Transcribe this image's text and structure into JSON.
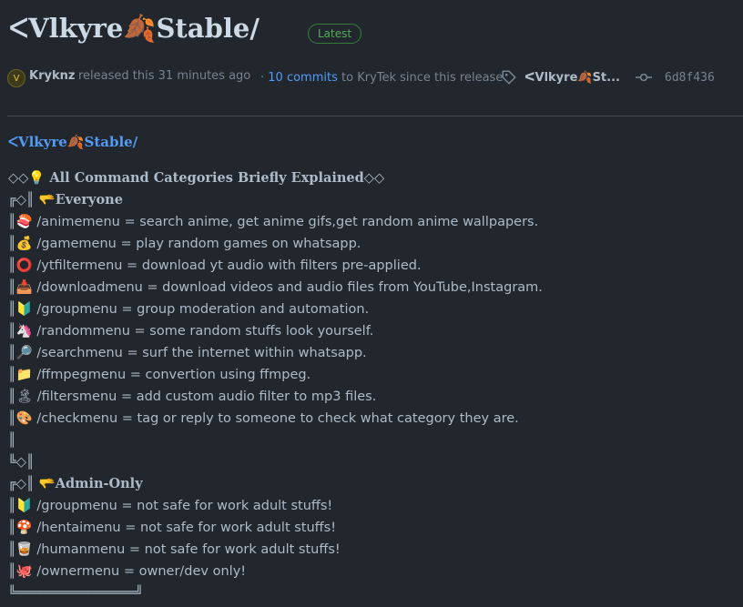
{
  "release": {
    "title": "⸢Vlkyre🍂Stable⸣",
    "title_display": "ᐸVlkyre🍂Stable∕",
    "latest_badge": "Latest"
  },
  "meta": {
    "avatar_glyph": "V",
    "author": "Kryknz",
    "released_text": "released this 31 minutes ago",
    "separator": "·",
    "commits_link": "10 commits",
    "commits_suffix": "to KryTek since this release",
    "tag_name": "ᐸVlkyre🍂St...",
    "commit_sha": "6d8f436",
    "icons": {
      "tag": "tag-icon",
      "commit": "git-commit-icon"
    }
  },
  "body": {
    "heading": "ᐸVlkyre🍂Stable∕",
    "lines": [
      {
        "text": "◇◇💡 All Command Categories Briefly Explained◇◇",
        "bold": true
      },
      {
        "text": "╔◇║ 🫳Everyone",
        "bold": true
      },
      {
        "text": "║🍣 /animemenu = search anime, get anime gifs,get random anime wallpapers."
      },
      {
        "text": "║💰 /gamemenu = play random games on whatsapp."
      },
      {
        "text": "║⭕ /ytfiltermenu = download yt audio with filters pre-applied."
      },
      {
        "text": "║📥 /downloadmenu = download videos and audio files from YouTube,Instagram."
      },
      {
        "text": "║🔰 /groupmenu = group moderation and automation."
      },
      {
        "text": "║🦄 /randommenu = some random stuffs look yourself."
      },
      {
        "text": "║🔎 /searchmenu = surf the internet within whatsapp."
      },
      {
        "text": "║📁 /ffmpegmenu = convertion using ffmpeg."
      },
      {
        "text": "║🏝 /filtersmenu = add custom audio filter to mp3 files."
      },
      {
        "text": "║🎨 /checkmenu = tag or reply to someone to check what category they are."
      },
      {
        "text": "║"
      },
      {
        "text": "╚◇║"
      },
      {
        "text": "╔◇║ 🫳Admin-Only",
        "bold": true
      },
      {
        "text": "║🔰 /groupmenu = not safe for work adult stuffs!"
      },
      {
        "text": "║🍄 /hentaimenu = not safe for work adult stuffs!"
      },
      {
        "text": "║🥃 /humanmenu = not safe for work adult stuffs!"
      },
      {
        "text": "║🐙 /ownermenu = owner/dev only!"
      },
      {
        "text": "╚═══════════════╝"
      }
    ]
  }
}
